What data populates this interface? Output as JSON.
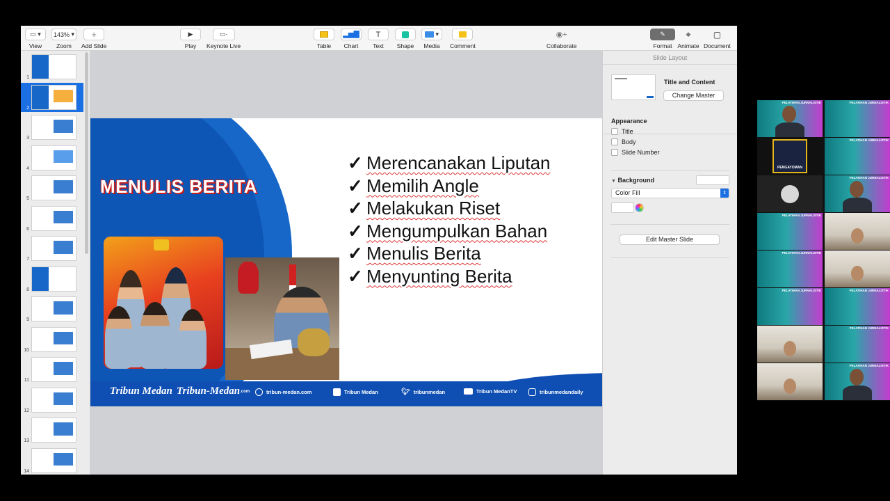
{
  "toolbar": {
    "view": "View",
    "zoom_value": "143%",
    "zoom": "Zoom",
    "add_slide": "Add Slide",
    "play": "Play",
    "keynote_live": "Keynote Live",
    "table": "Table",
    "chart": "Chart",
    "text": "Text",
    "shape": "Shape",
    "media": "Media",
    "comment": "Comment",
    "collaborate": "Collaborate",
    "format": "Format",
    "animate": "Animate",
    "document": "Document"
  },
  "sidebar": {
    "slides": [
      "1",
      "2",
      "3",
      "4",
      "5",
      "6",
      "7",
      "8",
      "9",
      "10",
      "11",
      "12",
      "13",
      "14"
    ],
    "selected": 2
  },
  "slide": {
    "title": "MENULIS BERITA",
    "bullets": [
      "Merencanakan Liputan",
      "Memilih Angle",
      "Melakukan Riset",
      "Mengumpulkan Bahan",
      "Menulis Berita",
      "Menyunting Berita"
    ],
    "check": "✓",
    "footer": {
      "logo1": "Tribun Medan",
      "logo2": "Tribun-Medan",
      "logo2_suffix": ".com",
      "web": "tribun-medan.com",
      "facebook": "Tribun Medan",
      "twitter": "tribunmedan",
      "youtube": "Tribun MedanTV",
      "instagram": "tribunmedandaily"
    }
  },
  "inspector": {
    "header": "Slide Layout",
    "layout_name": "Title and Content",
    "change_master": "Change Master",
    "appearance": "Appearance",
    "checks": [
      "Title",
      "Body",
      "Slide Number"
    ],
    "background": "Background",
    "fill": "Color Fill",
    "edit_master": "Edit Master Slide"
  },
  "zoom_grid": {
    "tile_title": "PELATIHAN JURNALISTIK",
    "pengayoman": "PENGAYOMAN"
  },
  "colors": {
    "slide_blue": "#1667c8",
    "selection": "#1a6fe3",
    "title_shadow": "#c71d1d"
  }
}
